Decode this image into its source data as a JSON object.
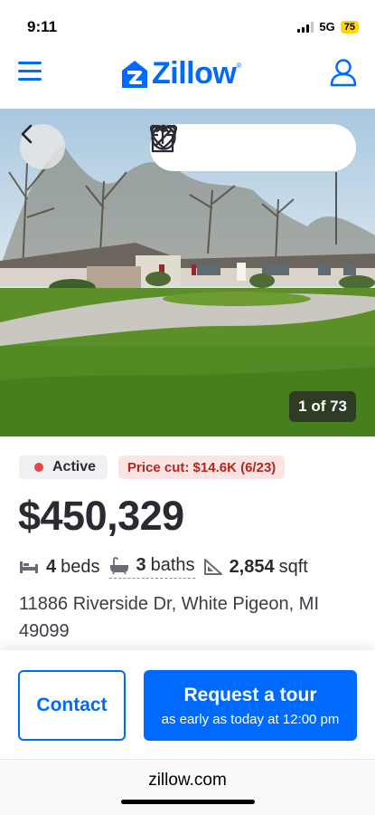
{
  "status": {
    "time": "9:11",
    "network": "5G",
    "battery": "75"
  },
  "header": {
    "logo_text": "Zillow",
    "logo_reg": "®"
  },
  "hero": {
    "photo_counter": "1 of 73"
  },
  "listing": {
    "status_label": "Active",
    "price_cut": "Price cut: $14.6K (6/23)",
    "price": "$450,329",
    "beds_value": "4",
    "beds_label": "beds",
    "baths_value": "3",
    "baths_label": "baths",
    "sqft_value": "2,854",
    "sqft_label": "sqft",
    "address": "11886 Riverside Dr, White Pigeon, MI 49099"
  },
  "cta": {
    "contact_label": "Contact",
    "tour_label": "Request a tour",
    "tour_sub": "as early as today at 12:00 pm"
  },
  "browser": {
    "url": "zillow.com"
  },
  "colors": {
    "brand": "#006aff",
    "status_dot": "#e44745",
    "price_cut_bg": "#fde4e4",
    "price_cut_text": "#b3261e"
  },
  "icons": [
    "menu-icon",
    "zillow-logo-icon",
    "account-icon",
    "chevron-left-icon",
    "heart-icon",
    "share-icon",
    "hide-icon",
    "more-icon",
    "bed-icon",
    "bath-icon",
    "sqft-icon"
  ]
}
